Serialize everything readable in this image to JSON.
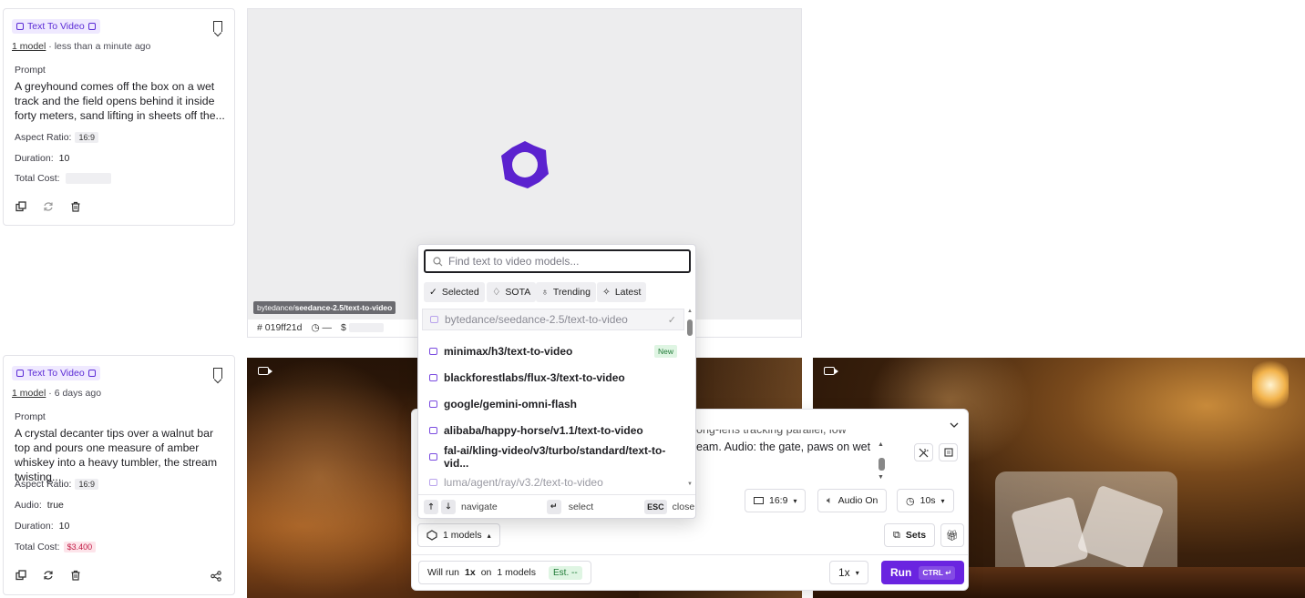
{
  "cards": [
    {
      "badge": "Text To Video",
      "models_link": "1 model",
      "time": "less than a minute ago",
      "prompt_label": "Prompt",
      "prompt": "A greyhound comes off the box on a wet track and the field opens behind it inside forty meters, sand lifting in sheets off the...",
      "aspect_label": "Aspect Ratio:",
      "aspect_value": "16:9",
      "duration_label": "Duration:",
      "duration_value": "10",
      "cost_label": "Total Cost:"
    },
    {
      "badge": "Text To Video",
      "models_link": "1 model",
      "time": "6 days ago",
      "prompt_label": "Prompt",
      "prompt": "A crystal decanter tips over a walnut bar top and pours one measure of amber whiskey into a heavy tumbler, the stream twisting...",
      "aspect_label": "Aspect Ratio:",
      "aspect_value": "16:9",
      "audio_label": "Audio:",
      "audio_value": "true",
      "duration_label": "Duration:",
      "duration_value": "10",
      "cost_label": "Total Cost:",
      "cost_value": "$3.400"
    }
  ],
  "tile": {
    "model_chip_prefix": "bytedance/",
    "model_chip_rest": "seedance-2.5/text-to-video",
    "id": "019ff21d",
    "time_dash": "—",
    "dollar": "$"
  },
  "composer": {
    "prompt_line1": "ong-lens tracking parallel, low",
    "prompt_line2": "eam. Audio: the gate, paws on wet",
    "aspect": "16:9",
    "audio": "Audio On",
    "duration": "10s",
    "models_button": "1 models",
    "sets": "Sets",
    "will_run_prefix": "Will run",
    "will_run_mult": "1x",
    "will_run_on": "on",
    "will_run_models": "1 models",
    "est": "Est. --",
    "multiplier": "1x",
    "run": "Run",
    "run_kbd": "CTRL ↵"
  },
  "dropdown": {
    "placeholder": "Find text to video models...",
    "filters": [
      "Selected",
      "SOTA",
      "Trending",
      "Latest"
    ],
    "items": [
      "bytedance/seedance-2.5/text-to-video",
      "minimax/h3/text-to-video",
      "blackforestlabs/flux-3/text-to-video",
      "google/gemini-omni-flash",
      "alibaba/happy-horse/v1.1/text-to-video",
      "fal-ai/kling-video/v3/turbo/standard/text-to-vid...",
      "luma/agent/ray/v3.2/text-to-video"
    ],
    "new_badge": "New",
    "nav_label": "navigate",
    "select_key": "↵",
    "select_label": "select",
    "esc_key": "ESC",
    "close_label": "close"
  },
  "colors": {
    "accent": "#6a24e0",
    "badge_bg": "#efe9ff",
    "cost_red": "#c11c45",
    "est_green": "#1f7a36"
  }
}
